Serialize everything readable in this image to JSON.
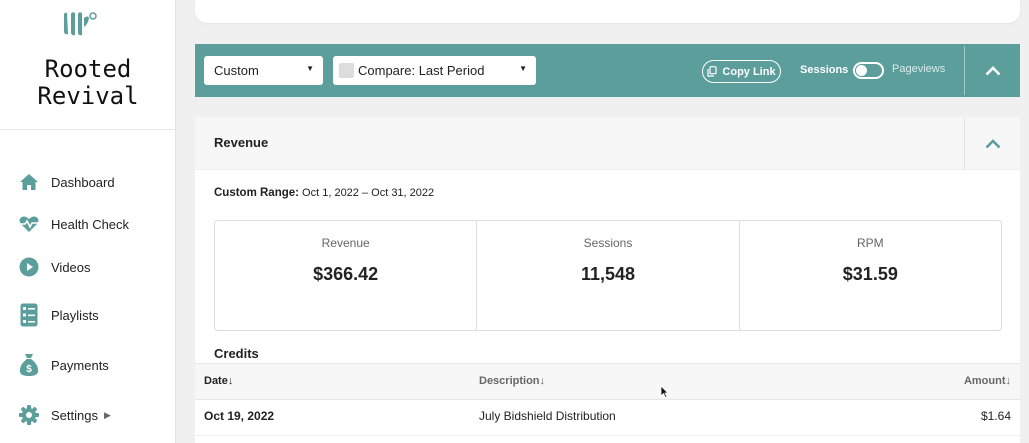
{
  "sidebar": {
    "brand_line1": "Rooted",
    "brand_line2": "Revival",
    "logo_icon": "leaf-logo-icon",
    "items": [
      {
        "label": "Dashboard",
        "icon": "home-icon"
      },
      {
        "label": "Health Check",
        "icon": "heartbeat-icon"
      },
      {
        "label": "Videos",
        "icon": "play-circle-icon"
      },
      {
        "label": "Playlists",
        "icon": "list-icon"
      },
      {
        "label": "Payments",
        "icon": "money-bag-icon"
      },
      {
        "label": "Settings",
        "icon": "gear-icon"
      }
    ]
  },
  "toolbar": {
    "range_select": "Custom",
    "compare_select": "Compare: Last Period",
    "copy_link": "Copy Link",
    "toggle_left": "Sessions",
    "toggle_right": "Pageviews",
    "toggle_state": "Sessions"
  },
  "revenue": {
    "title": "Revenue",
    "range_label": "Custom Range:",
    "range_value": "Oct 1, 2022 – Oct 31, 2022",
    "stats": [
      {
        "label": "Revenue",
        "value": "$366.42"
      },
      {
        "label": "Sessions",
        "value": "11,548"
      },
      {
        "label": "RPM",
        "value": "$31.59"
      }
    ]
  },
  "credits": {
    "title": "Credits",
    "columns": [
      "Date↓",
      "Description↓",
      "Amount↓"
    ],
    "rows": [
      {
        "date": "Oct 19, 2022",
        "description": "July Bidshield Distribution",
        "amount": "$1.64"
      }
    ]
  },
  "colors": {
    "teal": "#5b9e9b",
    "icon": "#5b9e9b"
  }
}
